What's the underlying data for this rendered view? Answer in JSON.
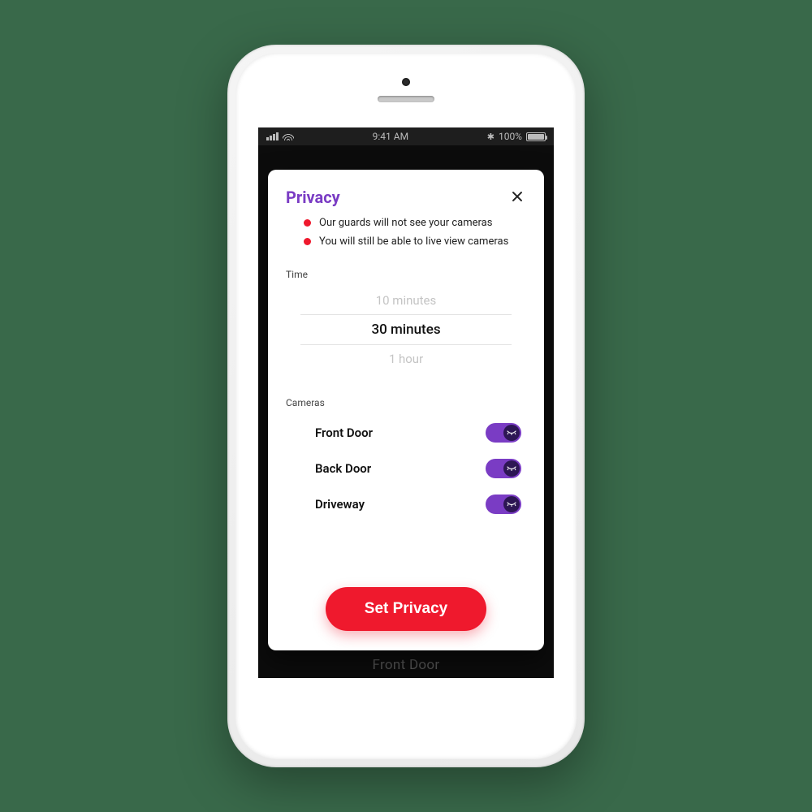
{
  "statusbar": {
    "time": "9:41 AM",
    "battery_pct": "100%"
  },
  "background_app": {
    "peek_label": "Front Door"
  },
  "modal": {
    "title": "Privacy",
    "bullets": [
      "Our guards will not see your cameras",
      "You will still be able to live view cameras"
    ],
    "time_section_label": "Time",
    "time_options": [
      {
        "label": "10 minutes",
        "selected": false
      },
      {
        "label": "30 minutes",
        "selected": true
      },
      {
        "label": "1 hour",
        "selected": false
      }
    ],
    "cameras_section_label": "Cameras",
    "cameras": [
      {
        "name": "Front Door",
        "enabled": true
      },
      {
        "name": "Back Door",
        "enabled": true
      },
      {
        "name": "Driveway",
        "enabled": true
      }
    ],
    "cta_label": "Set Privacy"
  }
}
